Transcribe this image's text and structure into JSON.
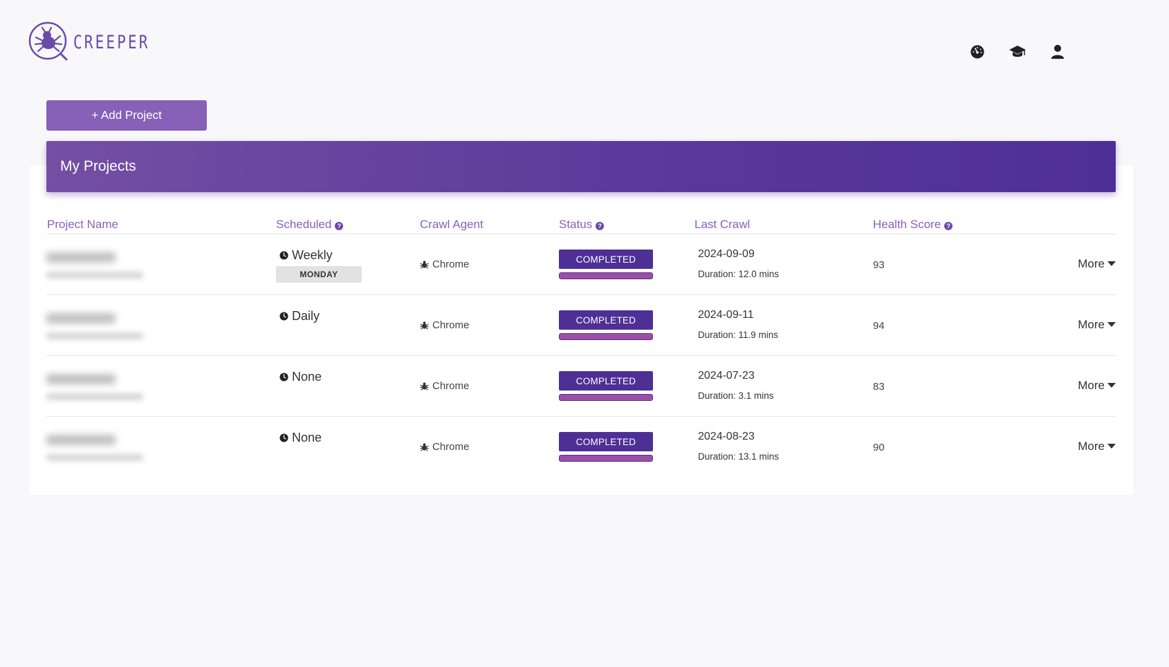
{
  "app": {
    "logo_text": "CREEPER",
    "brand_color": "#6b4aa8"
  },
  "top_nav": {
    "icons": [
      "dashboard-icon",
      "graduation-cap-icon",
      "user-icon"
    ]
  },
  "toolbar": {
    "add_project_label": "+ Add Project"
  },
  "card": {
    "title": "My Projects"
  },
  "table": {
    "headers": {
      "project_name": "Project Name",
      "scheduled": "Scheduled",
      "crawl_agent": "Crawl Agent",
      "status": "Status",
      "last_crawl": "Last Crawl",
      "health_score": "Health Score"
    },
    "help_glyph": "?",
    "rows": [
      {
        "schedule": "Weekly",
        "schedule_day": "MONDAY",
        "agent": "Chrome",
        "status": "COMPLETED",
        "progress": 1.0,
        "last_crawl_date": "2024-09-09",
        "duration": "Duration: 12.0 mins",
        "health_score": "93",
        "more_label": "More"
      },
      {
        "schedule": "Daily",
        "schedule_day": "",
        "agent": "Chrome",
        "status": "COMPLETED",
        "progress": 1.0,
        "last_crawl_date": "2024-09-11",
        "duration": "Duration: 11.9 mins",
        "health_score": "94",
        "more_label": "More"
      },
      {
        "schedule": "None",
        "schedule_day": "",
        "agent": "Chrome",
        "status": "COMPLETED",
        "progress": 1.0,
        "last_crawl_date": "2024-07-23",
        "duration": "Duration: 3.1 mins",
        "health_score": "83",
        "more_label": "More"
      },
      {
        "schedule": "None",
        "schedule_day": "",
        "agent": "Chrome",
        "status": "COMPLETED",
        "progress": 1.0,
        "last_crawl_date": "2024-08-23",
        "duration": "Duration: 13.1 mins",
        "health_score": "90",
        "more_label": "More"
      }
    ]
  }
}
